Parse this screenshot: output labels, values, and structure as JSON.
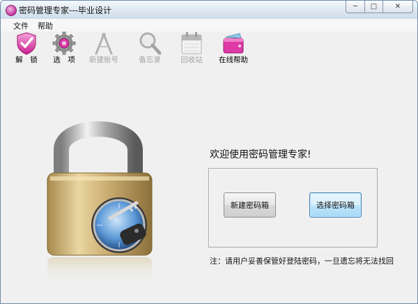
{
  "window": {
    "title": "密码管理专家---毕业设计"
  },
  "window_buttons": {
    "minimize": "─",
    "maximize": "□",
    "close": "✕"
  },
  "menu": [
    {
      "label": "文件"
    },
    {
      "label": "帮助"
    }
  ],
  "toolbar": [
    {
      "label": "解　锁",
      "icon": "shield-check-icon",
      "enabled": true
    },
    {
      "label": "选　项",
      "icon": "gear-icon",
      "enabled": true
    },
    {
      "label": "新建账号",
      "icon": "compass-icon",
      "enabled": false
    },
    {
      "label": "备忘录",
      "icon": "magnifier-icon",
      "enabled": false
    },
    {
      "label": "回收站",
      "icon": "calendar-icon",
      "enabled": false
    },
    {
      "label": "在线帮助",
      "icon": "wallet-icon",
      "enabled": true
    }
  ],
  "main": {
    "welcome": "欢迎使用密码管理专家!",
    "new_button": "新建密码箱",
    "select_button": "选择密码箱",
    "note": "注：请用户妥善保管好登陆密码，一旦遗忘将无法找回"
  },
  "colors": {
    "accent_pink": "#d6309c",
    "focus_blue": "#3c7fb1",
    "lock_gold": "#c9a85a"
  }
}
